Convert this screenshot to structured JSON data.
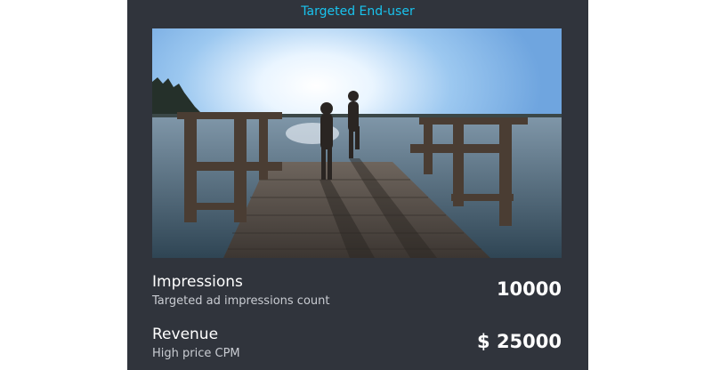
{
  "card": {
    "title": "Targeted End-user",
    "image_icon": "pier-kids-jumping-lake-photo"
  },
  "metrics": [
    {
      "label": "Impressions",
      "description": "Targeted ad impressions count",
      "value": "10000"
    },
    {
      "label": "Revenue",
      "description": "High price CPM",
      "value": "$ 25000"
    }
  ],
  "colors": {
    "card_bg": "#30343c",
    "title_accent": "#19c3ee",
    "text": "#ffffff",
    "subtext": "#c9ccd2"
  }
}
